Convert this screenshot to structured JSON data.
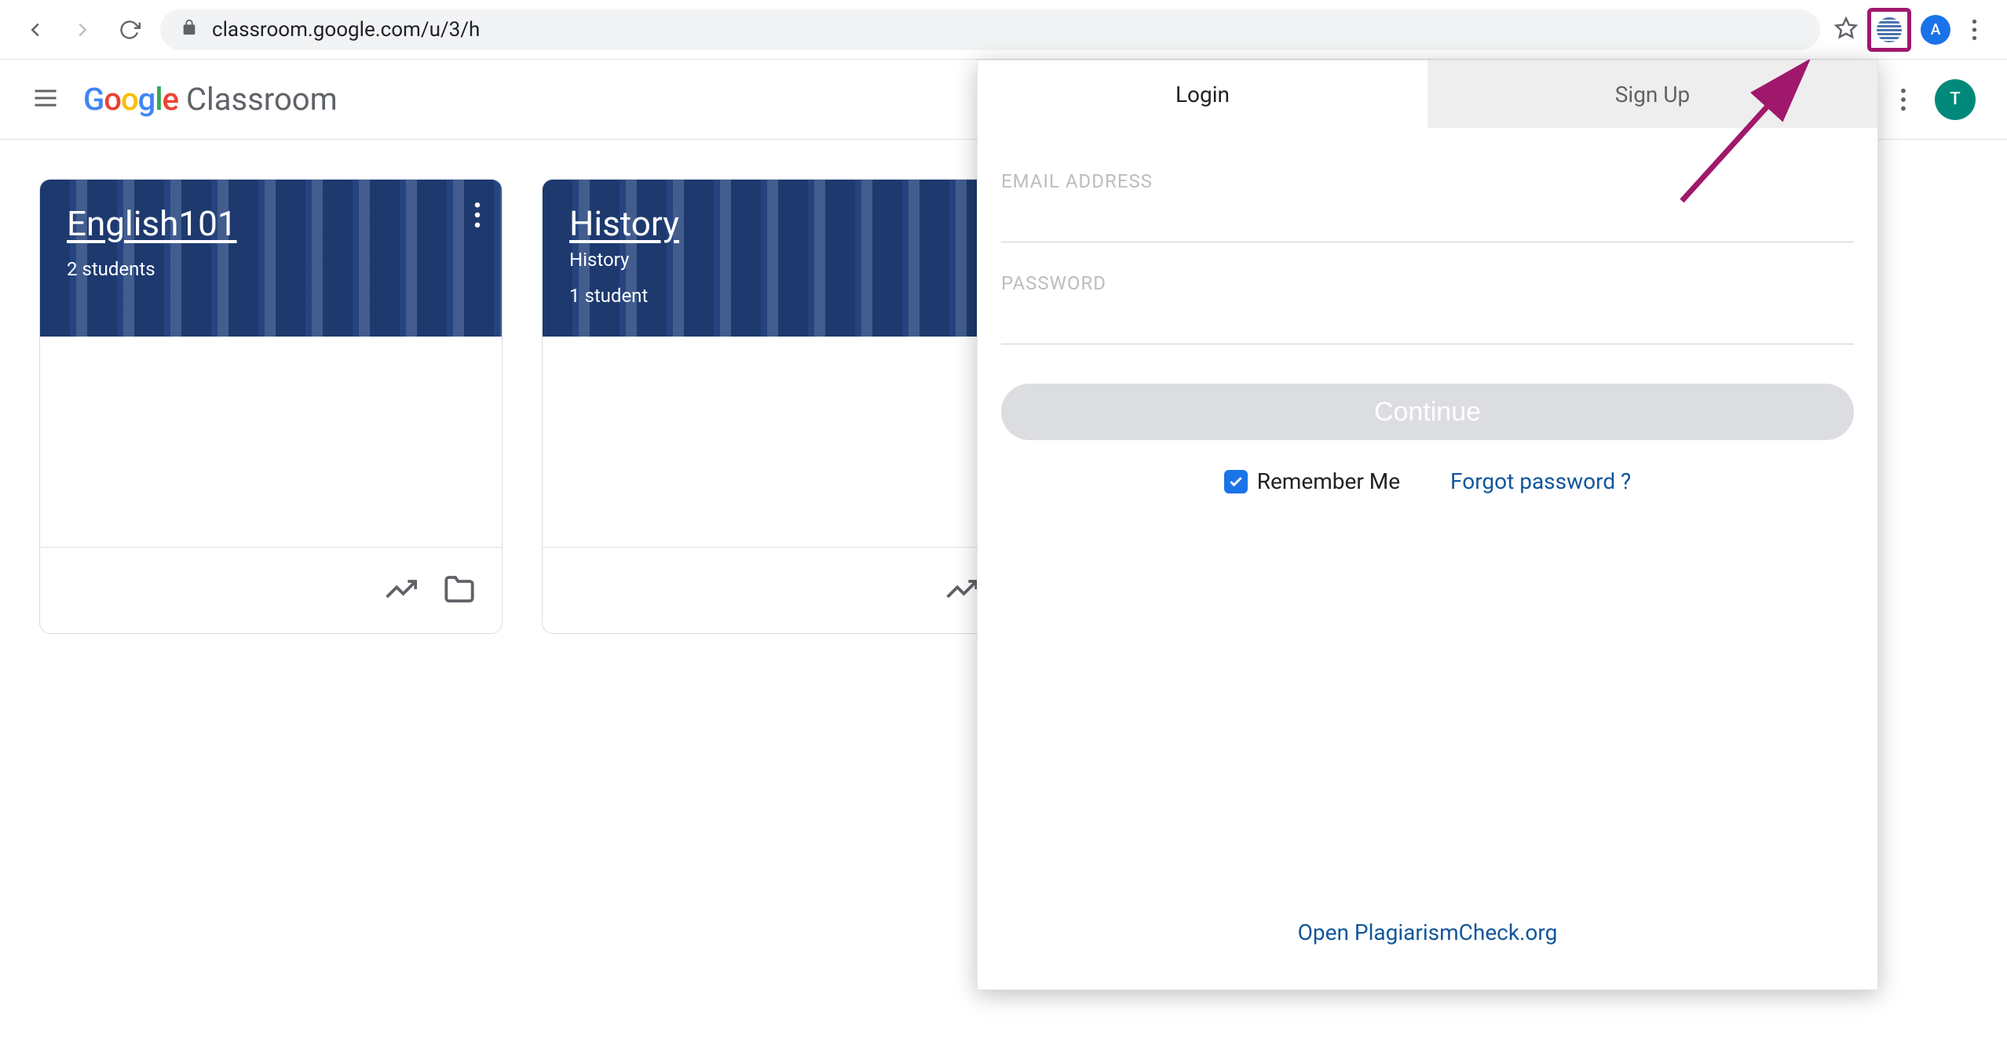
{
  "chrome": {
    "url": "classroom.google.com/u/3/h",
    "profile_initial": "A"
  },
  "app": {
    "logo_word": "Google",
    "logo_app": "Classroom",
    "avatar_initial": "T"
  },
  "cards": [
    {
      "title": "English101",
      "subtitle": "",
      "students": "2 students"
    },
    {
      "title": "History",
      "subtitle": "History",
      "students": "1 student"
    }
  ],
  "popup": {
    "tabs": {
      "login": "Login",
      "signup": "Sign Up"
    },
    "email_label": "EMAIL ADDRESS",
    "password_label": "PASSWORD",
    "continue": "Continue",
    "remember": "Remember Me",
    "forgot": "Forgot password ?",
    "open_link": "Open PlagiarismCheck.org"
  }
}
